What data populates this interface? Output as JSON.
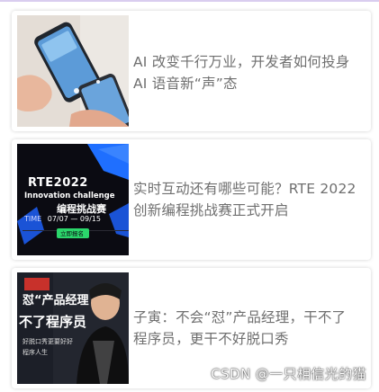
{
  "articles": [
    {
      "title_line1": "AI 改变千行万业，开发者如何投身",
      "title_line2": "AI 语音新“声”态"
    },
    {
      "title_line1": "实时互动还有哪些可能？RTE 2022",
      "title_line2": "创新编程挑战赛正式开启",
      "thumb": {
        "badge": "RTE2022",
        "subtitle": "Innovation challenge",
        "heading": "编程挑战赛",
        "time_label": "TIME",
        "dates": "07/07 — 09/15",
        "cta": "立即报名"
      }
    },
    {
      "title_line1": "子寅：不会“怼”产品经理，干不了",
      "title_line2": "程序员，更干不好脱口秀",
      "thumb": {
        "line1": "怼“产品经理",
        "line2": "不了程序员",
        "line3": "好脱口秀更要好好",
        "line4": "程序人生"
      }
    }
  ],
  "watermark": "CSDN @一只相信光的猫",
  "colors": {
    "accent_blue": "#1f6fff",
    "accent_green": "#2bd66b",
    "title_gray": "#6f6f6f"
  }
}
